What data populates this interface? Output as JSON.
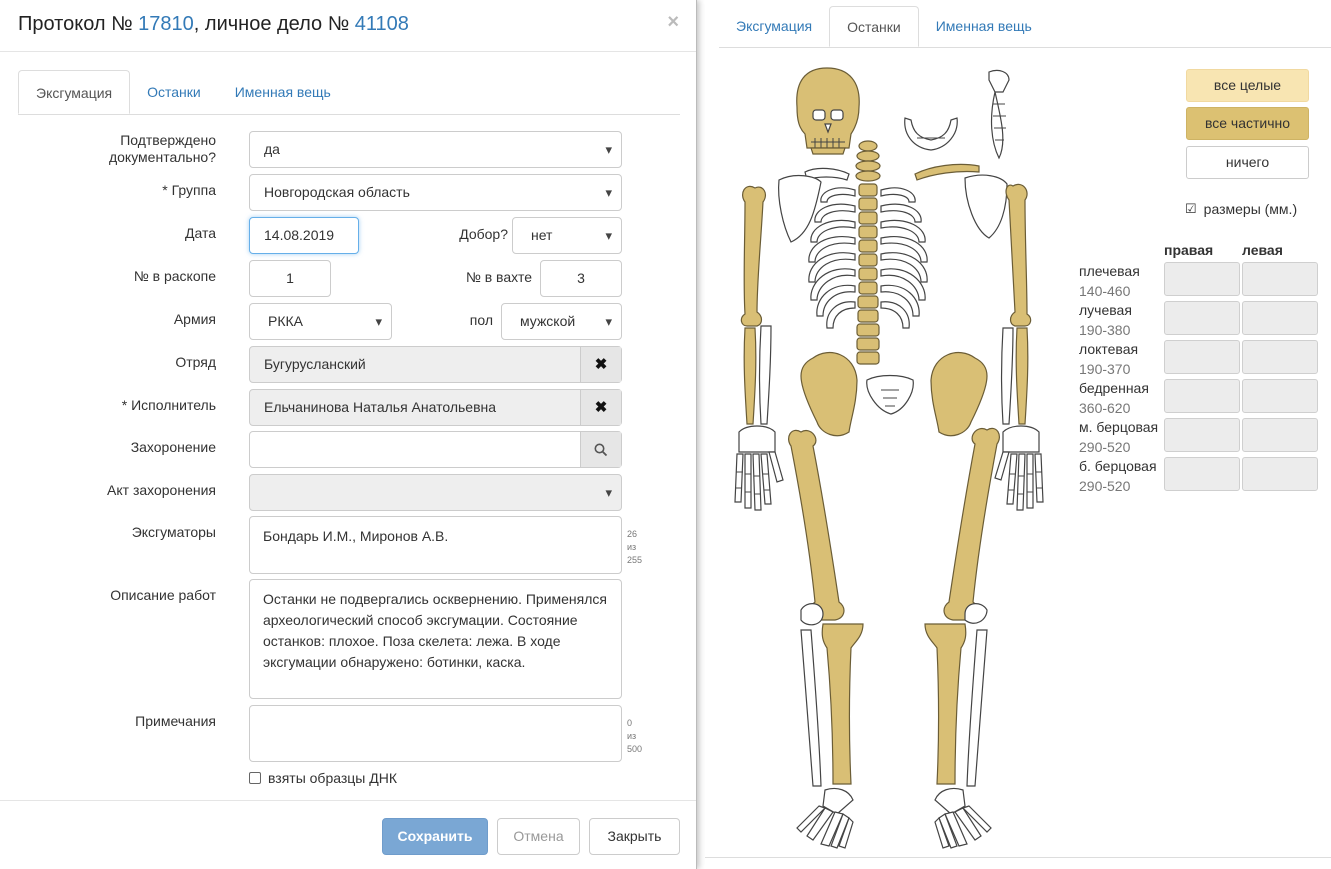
{
  "modal": {
    "title_prefix": "Протокол №",
    "protocol_number": "17810",
    "title_middle": ", личное дело №",
    "case_number": "41108",
    "close_glyph": "×",
    "tabs": [
      {
        "label": "Эксгумация",
        "active": true
      },
      {
        "label": "Останки",
        "active": false
      },
      {
        "label": "Именная вещь",
        "active": false
      }
    ],
    "form": {
      "confirmed_label": "Подтверждено документально?",
      "confirmed_value": "да",
      "group_label": "* Группа",
      "group_value": "Новгородская область",
      "date_label": "Дата",
      "date_value": "14.08.2019",
      "dobor_label": "Добор?",
      "dobor_value": "нет",
      "excavation_no_label": "№ в раскопе",
      "excavation_no_value": "1",
      "shift_no_label": "№ в вахте",
      "shift_no_value": "3",
      "army_label": "Армия",
      "army_value": "РККА",
      "sex_label": "пол",
      "sex_value": "мужской",
      "detachment_label": "Отряд",
      "detachment_value": "Бугурусланский",
      "executor_label": "* Исполнитель",
      "executor_value": "Ельчанинова Наталья Анатольевна",
      "burial_label": "Захоронение",
      "burial_value": "",
      "burial_act_label": "Акт захоронения",
      "burial_act_value": "",
      "exhumers_label": "Эксгуматоры",
      "exhumers_value": "Бондарь И.М., Миронов А.В.",
      "exhumers_count": "26",
      "exhumers_of": "из",
      "exhumers_max": "255",
      "work_desc_label": "Описание работ",
      "work_desc_value": "Останки не подвергались осквернению. Применялся археологический способ эксгумации. Состояние останков: плохое. Поза скелета: лежа. В ходе эксгумации обнаружено: ботинки, каска.",
      "notes_label": "Примечания",
      "notes_value": "",
      "notes_count": "0",
      "notes_of": "из",
      "notes_max": "500",
      "dna_label": "взяты образцы ДНК",
      "dna_checked": false,
      "clear_glyph": "✖",
      "search_glyph": "⚲"
    },
    "footer": {
      "save_label": "Сохранить",
      "cancel_label": "Отмена",
      "close_label": "Закрыть"
    }
  },
  "right_panel": {
    "tabs": [
      {
        "label": "Эксгумация",
        "active": false
      },
      {
        "label": "Останки",
        "active": true
      },
      {
        "label": "Именная вещь",
        "active": false
      }
    ],
    "buttons": {
      "all_whole": "все целые",
      "all_partial": "все частично",
      "nothing": "ничего"
    },
    "sizes_checkbox": {
      "label": "размеры (мм.)",
      "checked": true,
      "glyph": "☑"
    },
    "measurements": {
      "col_right": "правая",
      "col_left": "левая",
      "rows": [
        {
          "name": "плечевая",
          "range": "140-460"
        },
        {
          "name": "лучевая",
          "range": "190-380"
        },
        {
          "name": "локтевая",
          "range": "190-370"
        },
        {
          "name": "бедренная",
          "range": "360-620"
        },
        {
          "name": "м. берцовая",
          "range": "290-520"
        },
        {
          "name": "б. берцовая",
          "range": "290-520"
        }
      ]
    },
    "colors": {
      "bone_partial": "#d9bf75",
      "bone_whole": "#f8e5b2",
      "bone_none": "#ffffff"
    }
  }
}
